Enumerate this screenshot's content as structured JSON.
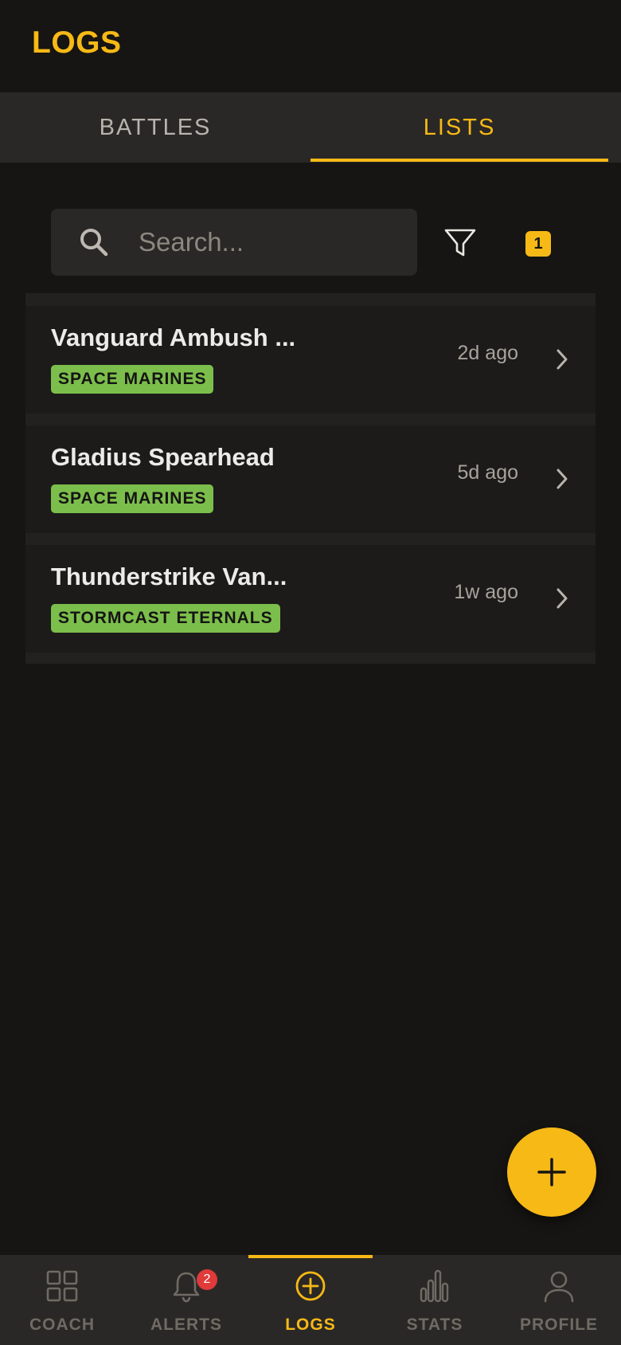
{
  "header": {
    "title": "LOGS"
  },
  "tabs": [
    {
      "label": "BATTLES",
      "active": false
    },
    {
      "label": "LISTS",
      "active": true
    }
  ],
  "search": {
    "placeholder": "Search...",
    "value": ""
  },
  "filter": {
    "icon": "filter-icon",
    "active_count": "1"
  },
  "lists": [
    {
      "title": "Vanguard Ambush ...",
      "faction": "SPACE MARINES",
      "time": "2d ago"
    },
    {
      "title": "Gladius Spearhead",
      "faction": "SPACE MARINES",
      "time": "5d ago"
    },
    {
      "title": "Thunderstrike Van...",
      "faction": "STORMCAST ETERNALS",
      "time": "1w ago"
    }
  ],
  "fab": {
    "icon": "plus-icon"
  },
  "bottom_nav": [
    {
      "label": "COACH",
      "icon": "grid-icon"
    },
    {
      "label": "ALERTS",
      "icon": "bell-icon",
      "badge": "2"
    },
    {
      "label": "LOGS",
      "icon": "add-circle-icon",
      "active": true
    },
    {
      "label": "STATS",
      "icon": "bar-chart-icon"
    },
    {
      "label": "PROFILE",
      "icon": "user-icon"
    }
  ],
  "colors": {
    "accent": "#f7b916",
    "background": "#161513",
    "surface": "#2a2826",
    "faction_badge": "#7cbe4b",
    "alert_badge": "#e03a3a"
  }
}
